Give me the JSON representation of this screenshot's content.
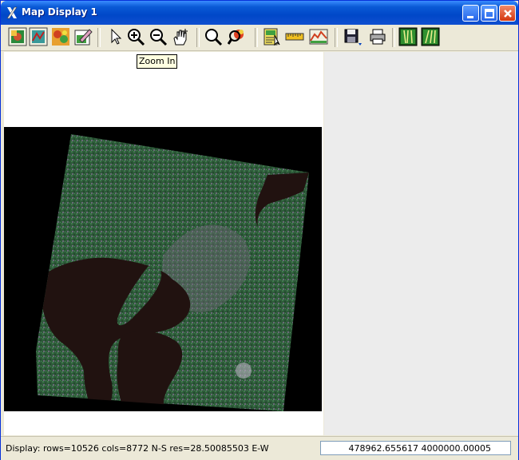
{
  "window": {
    "title": "Map Display 1"
  },
  "toolbar": {
    "items": [
      {
        "name": "raster-display-icon"
      },
      {
        "name": "vector-display-icon"
      },
      {
        "name": "terrain-display-icon"
      },
      {
        "name": "edit-layer-icon"
      },
      {
        "name": "select-pointer-icon"
      },
      {
        "name": "zoom-in-icon"
      },
      {
        "name": "zoom-out-icon"
      },
      {
        "name": "pan-icon"
      },
      {
        "name": "zoom-full-icon"
      },
      {
        "name": "zoom-region-icon"
      },
      {
        "name": "query-icon"
      },
      {
        "name": "measure-icon"
      },
      {
        "name": "profile-icon"
      },
      {
        "name": "save-icon"
      },
      {
        "name": "print-icon"
      },
      {
        "name": "map-layer-icon-1"
      },
      {
        "name": "map-layer-icon-2"
      }
    ]
  },
  "tooltip": {
    "text": "Zoom In"
  },
  "status": {
    "info": "Display: rows=10526 cols=8772 N-S res=28.50085503 E-W",
    "coordinates": "478962.655617 4000000.00005"
  },
  "colors": {
    "title_bar": "#0047c8",
    "tooltip_bg": "#ffffe1",
    "map_background": "#000000",
    "water": "#211210",
    "vegetation": "#2e5a3a"
  }
}
